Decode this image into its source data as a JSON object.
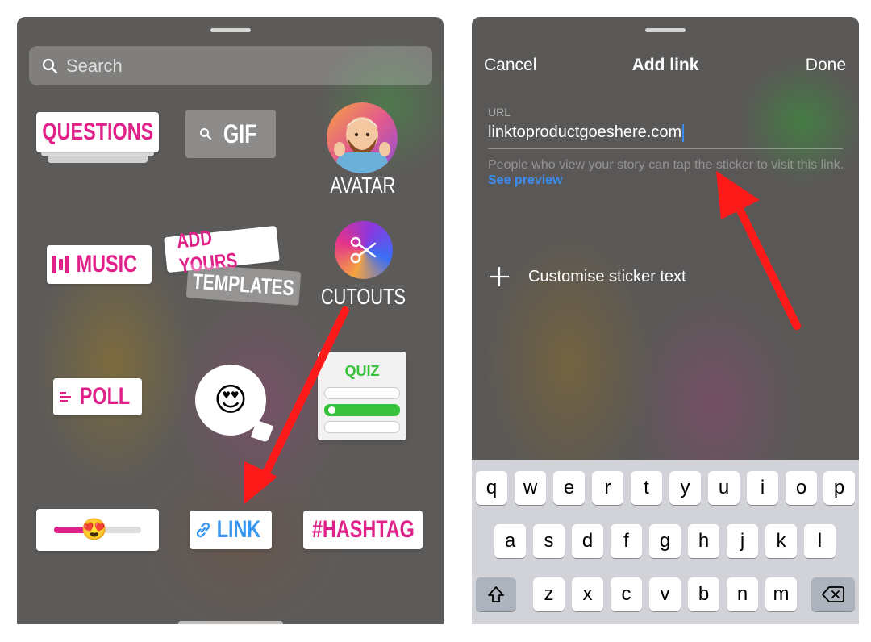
{
  "sticker_tray": {
    "search": {
      "placeholder": "Search"
    },
    "stickers": {
      "questions": "QUESTIONS",
      "gif": "GIF",
      "avatar": "AVATAR",
      "music": "MUSIC",
      "add_yours": "ADD YOURS",
      "templates": "TEMPLATES",
      "cutouts": "CUTOUTS",
      "poll": "POLL",
      "emoji": "😍",
      "quiz": "QUIZ",
      "slider_emoji": "😍",
      "slider_level": 0.45,
      "link": "LINK",
      "hashtag": "#HASHTAG"
    }
  },
  "add_link": {
    "cancel": "Cancel",
    "title": "Add link",
    "done": "Done",
    "url_label": "URL",
    "url_value": "linktoproductgoeshere.com",
    "helper_text": "People who view your story can tap the sticker to visit this link.",
    "see_preview": "See preview",
    "customise": "Customise sticker text"
  },
  "keyboard": {
    "row1": [
      "q",
      "w",
      "e",
      "r",
      "t",
      "y",
      "u",
      "i",
      "o",
      "p"
    ],
    "row2": [
      "a",
      "s",
      "d",
      "f",
      "g",
      "h",
      "j",
      "k",
      "l"
    ],
    "row3": [
      "z",
      "x",
      "c",
      "v",
      "b",
      "n",
      "m"
    ]
  },
  "colors": {
    "sticker_pink": "#e0218a",
    "link_blue": "#3897f0",
    "quiz_green": "#38c23c",
    "arrow_red": "#ff1a1a",
    "caret_blue": "#3a8df0"
  },
  "icons": {
    "search": "search-icon",
    "gif_search": "search-icon",
    "link": "link-icon",
    "scissors": "scissors-icon",
    "plus": "plus-icon",
    "shift": "shift-icon",
    "backspace": "backspace-icon"
  }
}
